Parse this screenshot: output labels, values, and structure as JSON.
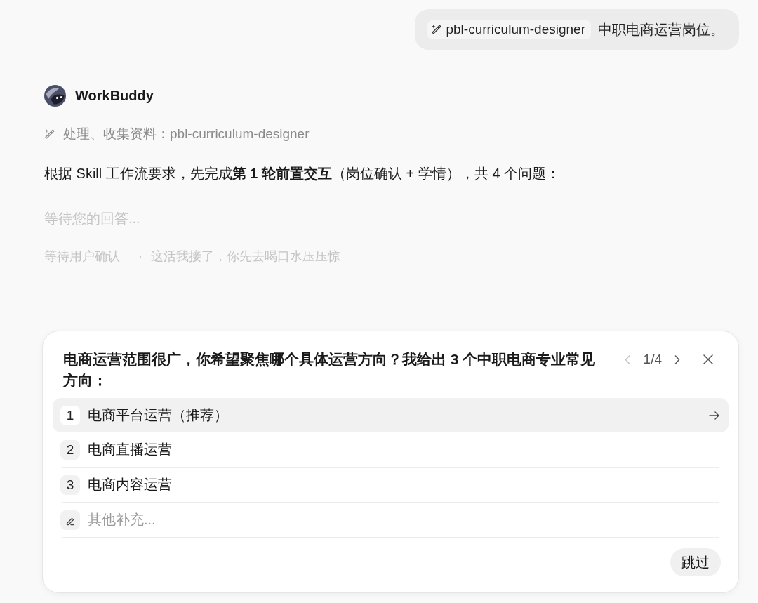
{
  "user_message": {
    "skill_chip": "pbl-curriculum-designer",
    "text": "中职电商运营岗位。"
  },
  "assistant": {
    "name": "WorkBuddy",
    "tool_status": "处理、收集资料：pbl-curriculum-designer",
    "message": "根据 Skill 工作流要求，先完成**第 1 轮前置交互**（岗位确认 + 学情），共 4 个问题：",
    "waiting": "等待您的回答...",
    "status": "等待用户确认",
    "separator": "·",
    "status_note": "这活我接了，你先去喝口水压压惊"
  },
  "question_card": {
    "question": "电商运营范围很广，你希望聚焦哪个具体运营方向？我给出 3 个中职电商专业常见方向：",
    "pager": {
      "label": "1/4",
      "prev_disabled": true,
      "next_disabled": false
    },
    "options": [
      {
        "number": "1",
        "label": "电商平台运营（推荐）",
        "selected": true
      },
      {
        "number": "2",
        "label": "电商直播运营",
        "selected": false
      },
      {
        "number": "3",
        "label": "电商内容运营",
        "selected": false
      }
    ],
    "other": {
      "placeholder": "其他补充..."
    },
    "skip_button": "跳过"
  }
}
